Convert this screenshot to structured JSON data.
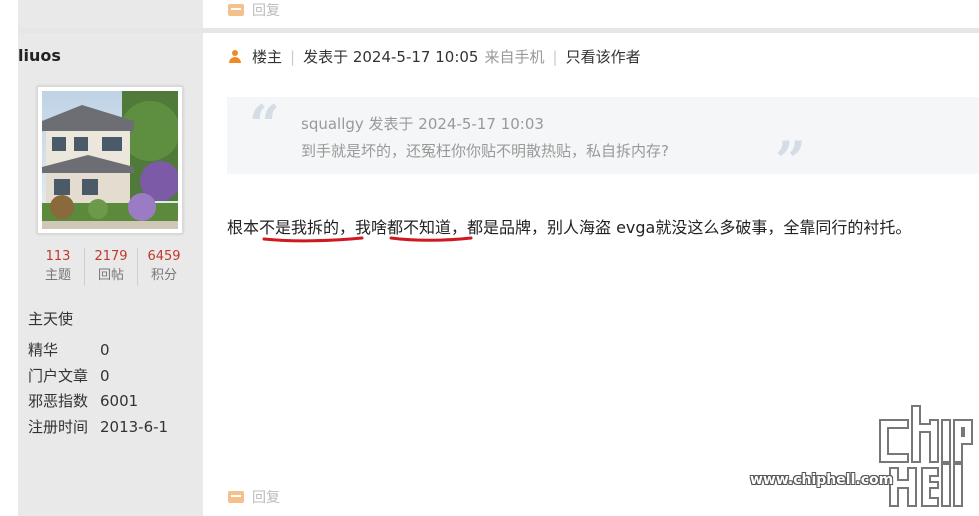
{
  "post": {
    "reply_label": "回复",
    "author_badge": "楼主",
    "posted_at": "发表于 2024-5-17 10:05",
    "source": "来自手机",
    "only_author": "只看该作者",
    "body": "根本不是我拆的，我啥都不知道，都是品牌，别人海盗 evga就没这么多破事，全靠同行的衬托。"
  },
  "quote": {
    "meta": "squallgy 发表于 2024-5-17 10:03",
    "text": "到手就是坏的，还冤枉你你贴不明散热贴，私自拆内存?"
  },
  "user": {
    "name": "liuos",
    "rank": "主天使",
    "stats": [
      {
        "value": "113",
        "label": "主题"
      },
      {
        "value": "2179",
        "label": "回帖"
      },
      {
        "value": "6459",
        "label": "积分"
      }
    ],
    "info": [
      {
        "key": "精华",
        "value": "0"
      },
      {
        "key": "门户文章",
        "value": "0"
      },
      {
        "key": "邪恶指数",
        "value": "6001"
      },
      {
        "key": "注册时间",
        "value": "2013-6-1"
      }
    ]
  },
  "watermark": {
    "url": "www.chiphell.com",
    "logo_text": "chip hell"
  },
  "colors": {
    "accent_orange": "#f08a24",
    "stat_red": "#c0392b",
    "underline_red": "#d0191f",
    "sidebar_bg": "#e9e9e9"
  },
  "icons": [
    "reply-icon",
    "user-icon",
    "quote-open-icon",
    "quote-close-icon"
  ]
}
